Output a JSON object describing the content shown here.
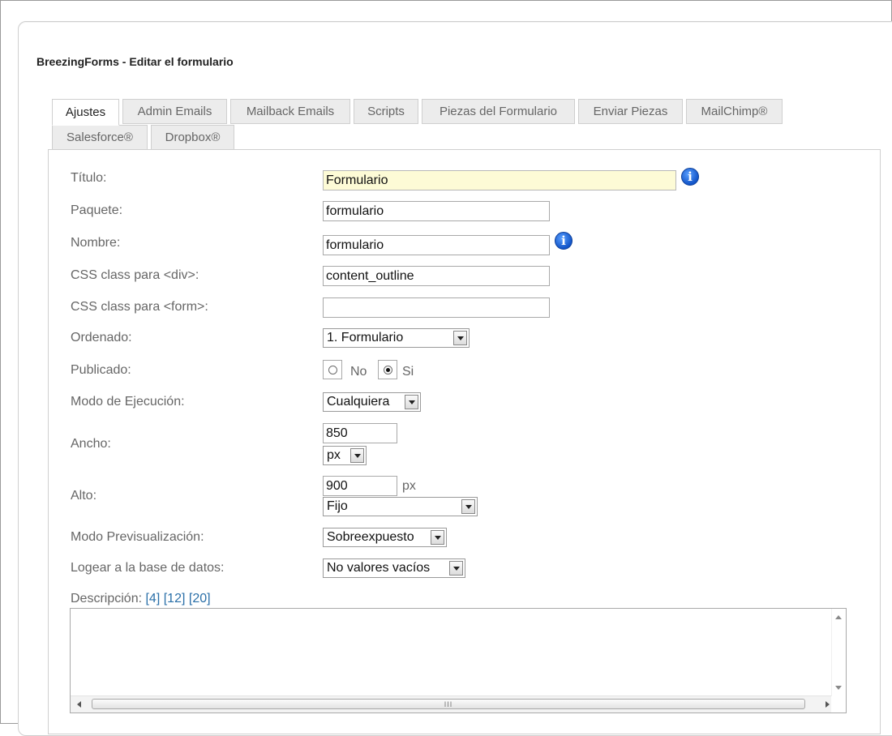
{
  "page": {
    "title": "BreezingForms - Editar el formulario"
  },
  "tabs": [
    {
      "label": "Ajustes",
      "active": true
    },
    {
      "label": "Admin Emails"
    },
    {
      "label": "Mailback Emails"
    },
    {
      "label": "Scripts"
    },
    {
      "label": "Piezas del Formulario"
    },
    {
      "label": "Enviar Piezas"
    },
    {
      "label": "MailChimp®"
    },
    {
      "label": "Salesforce®"
    },
    {
      "label": "Dropbox®"
    }
  ],
  "form": {
    "titulo": {
      "label": "Título:",
      "value": "Formulario"
    },
    "paquete": {
      "label": "Paquete:",
      "value": "formulario"
    },
    "nombre": {
      "label": "Nombre:",
      "value": "formulario"
    },
    "css_div": {
      "label": "CSS class para <div>:",
      "value": "content_outline"
    },
    "css_form": {
      "label": "CSS class para <form>:",
      "value": ""
    },
    "ordenado": {
      "label": "Ordenado:",
      "value": "1. Formulario"
    },
    "publicado": {
      "label": "Publicado:",
      "option_no": "No",
      "option_si": "Si",
      "selected": "Si"
    },
    "modo_ejecucion": {
      "label": "Modo de Ejecución:",
      "value": "Cualquiera"
    },
    "ancho": {
      "label": "Ancho:",
      "value": "850",
      "unit": "px"
    },
    "alto": {
      "label": "Alto:",
      "value": "900",
      "unit": "px",
      "mode": "Fijo"
    },
    "modo_previsualizacion": {
      "label": "Modo Previsualización:",
      "value": "Sobreexpuesto"
    },
    "logear": {
      "label": "Logear a la base de datos:",
      "value": "No valores vacíos"
    },
    "descripcion": {
      "label": "Descripción:",
      "links": [
        "[4]",
        "[12]",
        "[20]"
      ],
      "value": ""
    }
  },
  "scrollbar": {
    "thumb_grip": "III"
  },
  "icons": {
    "info": "info-icon"
  },
  "colors": {
    "focused_input_bg": "#fdfbd6",
    "link": "#2a6fa8",
    "info_icon": "#1a63d8"
  }
}
